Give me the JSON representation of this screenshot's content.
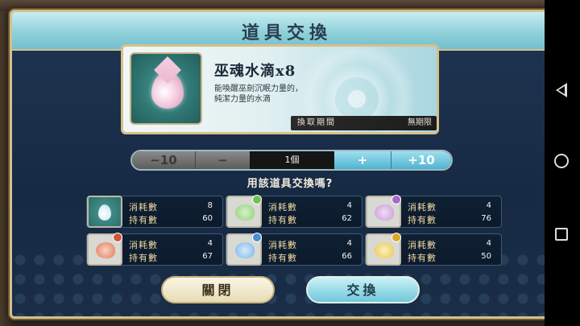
{
  "dialog": {
    "title": "道具交換"
  },
  "item": {
    "name": "巫魂水滴x8",
    "description_line1": "能喚醒巫劍沉眠力量的，",
    "description_line2": "純潔力量的水滴",
    "period_label": "換取期間",
    "period_value": "無期限"
  },
  "quantity": {
    "minus10_label": "−10",
    "minus_label": "−",
    "count": "1個",
    "plus_label": "+",
    "plus10_label": "+10"
  },
  "question": "用該道具交換嗎?",
  "materials": [
    {
      "icon": "water-drop-icon",
      "cost_label": "消耗數",
      "cost": "8",
      "owned_label": "持有數",
      "owned": "60"
    },
    {
      "icon": "green-spirit-icon",
      "cost_label": "消耗數",
      "cost": "4",
      "owned_label": "持有數",
      "owned": "62"
    },
    {
      "icon": "purple-spirit-icon",
      "cost_label": "消耗數",
      "cost": "4",
      "owned_label": "持有數",
      "owned": "76"
    },
    {
      "icon": "red-spirit-icon",
      "cost_label": "消耗數",
      "cost": "4",
      "owned_label": "持有數",
      "owned": "67"
    },
    {
      "icon": "blue-spirit-icon",
      "cost_label": "消耗數",
      "cost": "4",
      "owned_label": "持有數",
      "owned": "66"
    },
    {
      "icon": "yellow-spirit-icon",
      "cost_label": "消耗數",
      "cost": "4",
      "owned_label": "持有數",
      "owned": "50"
    }
  ],
  "buttons": {
    "close": "關閉",
    "exchange": "交換"
  },
  "colors": {
    "panel": "#172a44",
    "gold_border": "#d6c08a",
    "title_bar": "#8fd0da",
    "accent_blue": "#4fb4cf",
    "label_gold": "#f0d9a0",
    "green_spirit": "#8fd07a",
    "purple_spirit": "#c79ad8",
    "red_spirit": "#e07a5a",
    "blue_spirit": "#7ab4e6",
    "yellow_spirit": "#e8c64a"
  }
}
